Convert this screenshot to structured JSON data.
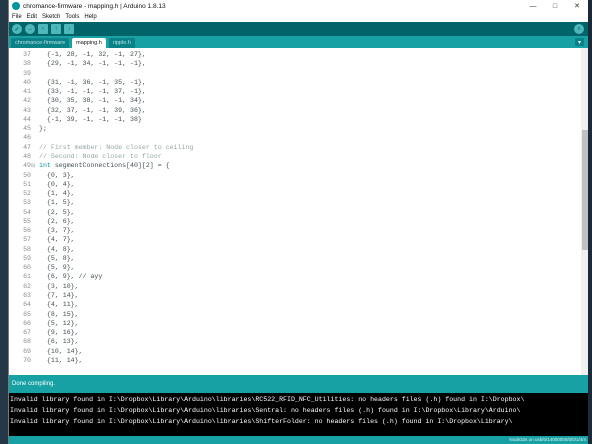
{
  "window": {
    "title": "chromance-firmware - mapping.h | Arduino 1.8.13",
    "controls": [
      "—",
      "□",
      "✕"
    ]
  },
  "menus": [
    "File",
    "Edit",
    "Sketch",
    "Tools",
    "Help"
  ],
  "toolbar": {
    "verify": "verify-icon",
    "upload": "upload-icon",
    "new": "new-icon",
    "open": "open-icon",
    "save": "save-icon",
    "serial": "serial-monitor-icon"
  },
  "tabs": [
    "chromance-firmware",
    "mapping.h",
    "ripple.h"
  ],
  "active_tab": "mapping.h",
  "lines": [
    {
      "n": "37",
      "t": "  {-1, 28, -1, 32, -1, 27},"
    },
    {
      "n": "38",
      "t": "  {29, -1, 34, -1, -1, -1},"
    },
    {
      "n": "39",
      "t": ""
    },
    {
      "n": "40",
      "t": "  {31, -1, 36, -1, 35, -1},"
    },
    {
      "n": "41",
      "t": "  {33, -1, -1, -1, 37, -1},"
    },
    {
      "n": "42",
      "t": "  {30, 35, 38, -1, -1, 34},"
    },
    {
      "n": "43",
      "t": "  {32, 37, -1, -1, 39, 36},"
    },
    {
      "n": "44",
      "t": "  {-1, 39, -1, -1, -1, 38}"
    },
    {
      "n": "45",
      "t": "};"
    },
    {
      "n": "46",
      "t": ""
    },
    {
      "n": "47",
      "t": "// First member: Node closer to ceiling"
    },
    {
      "n": "48",
      "t": "// Second: Node closer to floor"
    },
    {
      "n": "49",
      "t": "int segmentConnections[40][2] = {"
    },
    {
      "n": "50",
      "t": "  {0, 3},"
    },
    {
      "n": "51",
      "t": "  {0, 4},"
    },
    {
      "n": "52",
      "t": "  {1, 4},"
    },
    {
      "n": "53",
      "t": "  {1, 5},"
    },
    {
      "n": "54",
      "t": "  {2, 5},"
    },
    {
      "n": "55",
      "t": "  {2, 6},"
    },
    {
      "n": "56",
      "t": "  {3, 7},"
    },
    {
      "n": "57",
      "t": "  {4, 7},"
    },
    {
      "n": "58",
      "t": "  {4, 8},"
    },
    {
      "n": "59",
      "t": "  {5, 8},"
    },
    {
      "n": "60",
      "t": "  {5, 9},"
    },
    {
      "n": "61",
      "t": "  {6, 9}, // ayy"
    },
    {
      "n": "62",
      "t": "  {3, 10},"
    },
    {
      "n": "63",
      "t": "  {7, 14},"
    },
    {
      "n": "64",
      "t": "  {4, 11},"
    },
    {
      "n": "65",
      "t": "  {8, 15},"
    },
    {
      "n": "66",
      "t": "  {5, 12},"
    },
    {
      "n": "67",
      "t": "  {9, 16},"
    },
    {
      "n": "68",
      "t": "  {6, 13},"
    },
    {
      "n": "69",
      "t": "  {10, 14},"
    },
    {
      "n": "70",
      "t": "  {11, 14},"
    }
  ],
  "status": "Done compiling.",
  "console": [
    "Invalid library found in I:\\Dropbox\\Library\\Arduino\\libraries\\RC522_RFID_NFC_Utilities: no headers files (.h) found in I:\\Dropbox\\",
    "Invalid library found in I:\\Dropbox\\Library\\Arduino\\libraries\\Sentral: no headers files (.h) found in I:\\Dropbox\\Library\\Arduino\\",
    "Invalid library found in I:\\Dropbox\\Library\\Arduino\\libraries\\ShifterFolder: no headers files (.h) found in I:\\Dropbox\\Library\\"
  ],
  "board_info": "Node32s on usb/0/14000000/0/0/1/4/4"
}
